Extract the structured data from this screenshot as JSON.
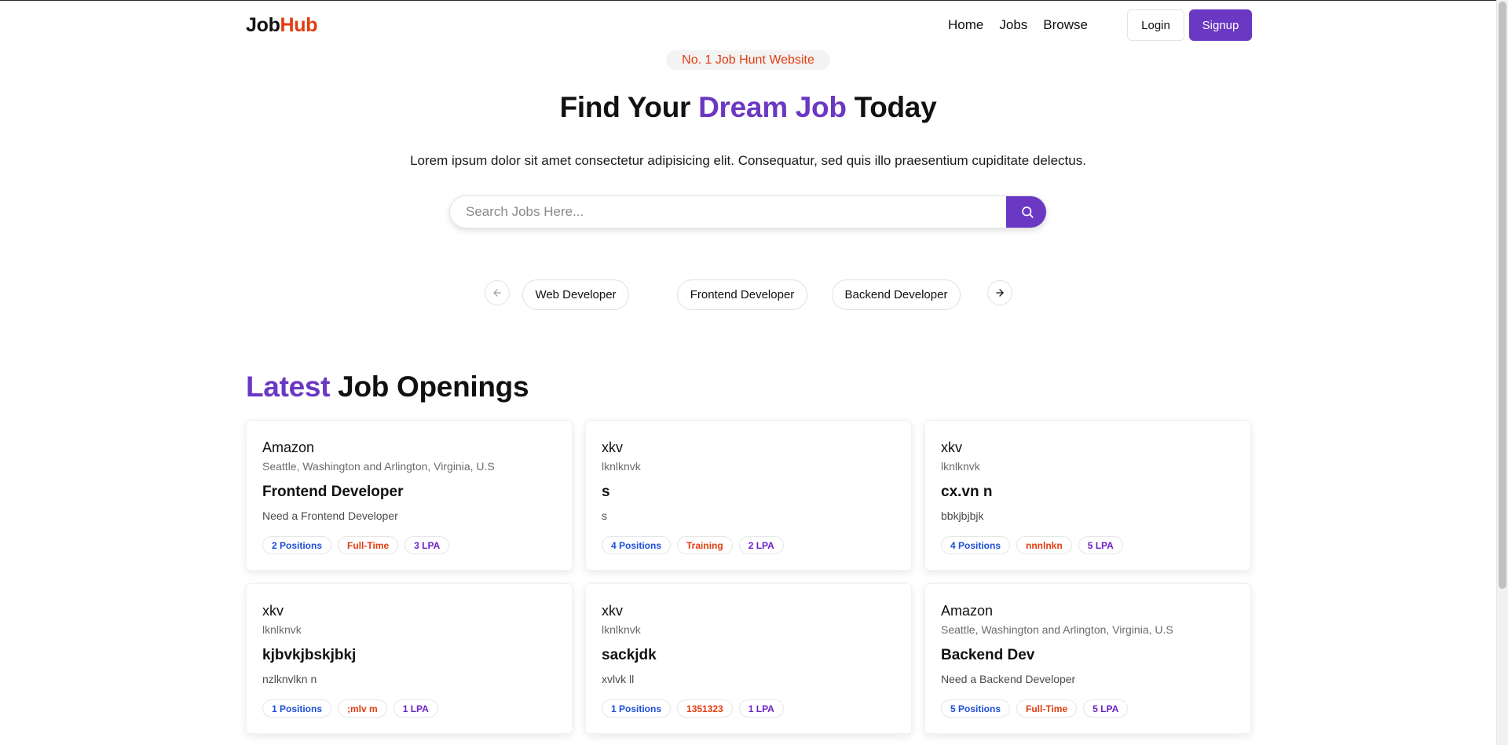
{
  "brand": {
    "job": "Job",
    "hub": "Hub"
  },
  "nav": {
    "links": [
      "Home",
      "Jobs",
      "Browse"
    ],
    "login": "Login",
    "signup": "Signup"
  },
  "hero": {
    "badge": "No. 1 Job Hunt Website",
    "title_pre": "Find Your ",
    "title_accent": "Dream Job",
    "title_post": " Today",
    "description": "Lorem ipsum dolor sit amet consectetur adipisicing elit. Consequatur, sed quis illo praesentium cupiditate delectus."
  },
  "search": {
    "placeholder": "Search Jobs Here...",
    "value": ""
  },
  "categories": [
    "Web Developer",
    "Frontend Developer",
    "Backend Developer"
  ],
  "section": {
    "accent": "Latest",
    "rest": " Job Openings"
  },
  "jobs": [
    {
      "company": "Amazon",
      "location": "Seattle, Washington and Arlington, Virginia, U.S",
      "title": "Frontend Developer",
      "description": "Need a Frontend Developer",
      "positions": "2 Positions",
      "type": "Full-Time",
      "salary": "3 LPA"
    },
    {
      "company": "xkv",
      "location": "lknlknvk",
      "title": "s",
      "description": "s",
      "positions": "4 Positions",
      "type": "Training",
      "salary": "2 LPA"
    },
    {
      "company": "xkv",
      "location": "lknlknvk",
      "title": "cx.vn n",
      "description": "bbkjbjbjk",
      "positions": "4 Positions",
      "type": "nnnlnkn",
      "salary": "5 LPA"
    },
    {
      "company": "xkv",
      "location": "lknlknvk",
      "title": "kjbvkjbskjbkj",
      "description": "nzlknvlkn n",
      "positions": "1 Positions",
      "type": ";mlv m",
      "salary": "1 LPA"
    },
    {
      "company": "xkv",
      "location": "lknlknvk",
      "title": "sackjdk",
      "description": "xvlvk ll",
      "positions": "1 Positions",
      "type": "1351323",
      "salary": "1 LPA"
    },
    {
      "company": "Amazon",
      "location": "Seattle, Washington and Arlington, Virginia, U.S",
      "title": "Backend Dev",
      "description": "Need a Backend Developer",
      "positions": "5 Positions",
      "type": "Full-Time",
      "salary": "5 LPA"
    }
  ],
  "colors": {
    "brand_purple": "#6a38c2",
    "brand_red": "#e23c0f",
    "tag_blue": "#1d4ed8",
    "tag_purple": "#6b21c8"
  },
  "icons": {
    "search": "search-icon",
    "prev": "arrow-left-icon",
    "next": "arrow-right-icon"
  }
}
